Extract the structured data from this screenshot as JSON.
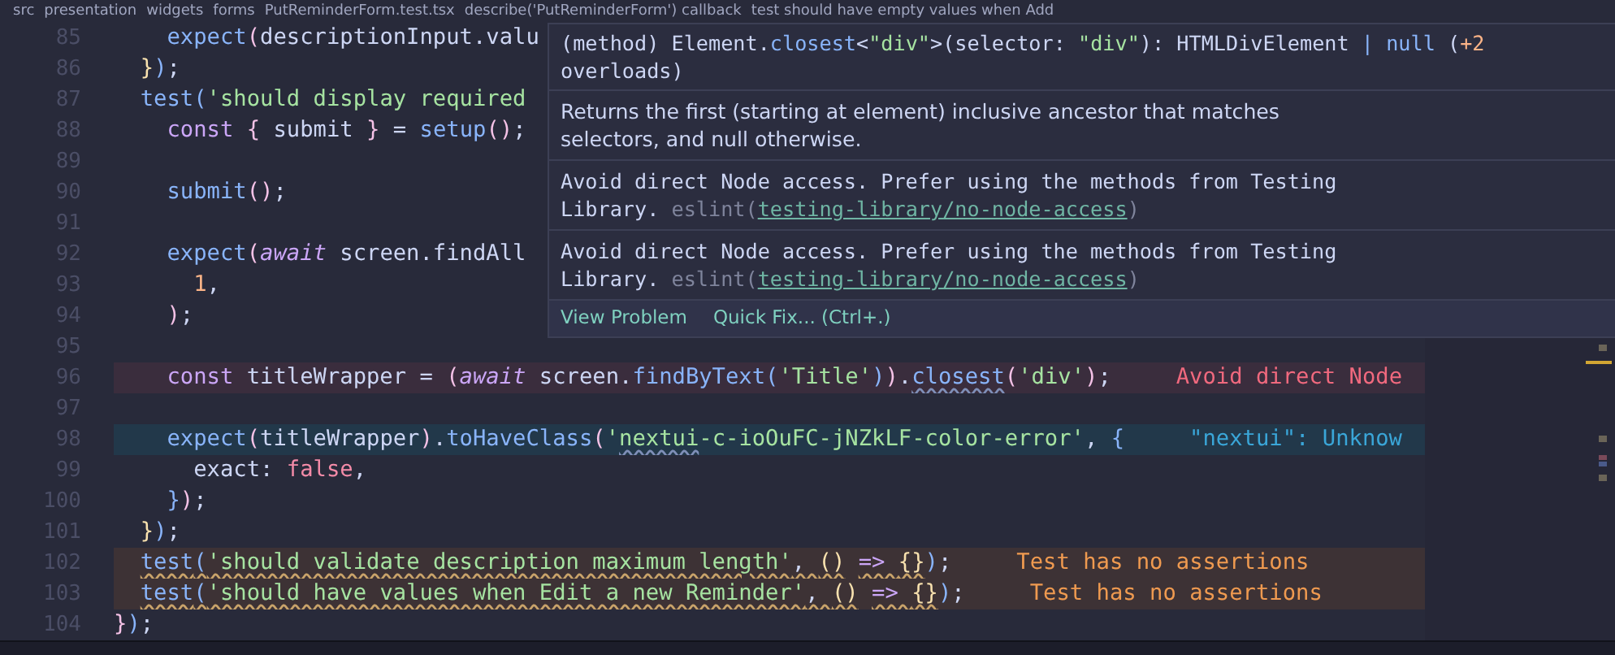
{
  "breadcrumb": [
    "src",
    "presentation",
    "widgets",
    "forms",
    "PutReminderForm.test.tsx",
    "describe('PutReminderForm') callback",
    "test should have empty values when Add"
  ],
  "lines": [
    {
      "number": "85",
      "tokens": [
        {
          "text": "    expect",
          "kind": "fn"
        },
        {
          "text": "(",
          "kind": "br2"
        },
        {
          "text": "descriptionInput.valu",
          "kind": "plain"
        }
      ]
    },
    {
      "number": "86",
      "tokens": [
        {
          "text": "  }",
          "kind": "br1"
        },
        {
          "text": ")",
          "kind": "br3"
        },
        {
          "text": ";",
          "kind": "plain"
        }
      ]
    },
    {
      "number": "87",
      "tokens": [
        {
          "text": "  test",
          "kind": "fn"
        },
        {
          "text": "(",
          "kind": "br3"
        },
        {
          "text": "'should display required",
          "kind": "str"
        }
      ]
    },
    {
      "number": "88",
      "tokens": [
        {
          "text": "    const ",
          "kind": "kw"
        },
        {
          "text": "{",
          "kind": "br2"
        },
        {
          "text": " submit ",
          "kind": "plain"
        },
        {
          "text": "}",
          "kind": "br2"
        },
        {
          "text": " = ",
          "kind": "plain"
        },
        {
          "text": "setup",
          "kind": "fn"
        },
        {
          "text": "()",
          "kind": "br2"
        },
        {
          "text": ";",
          "kind": "plain"
        }
      ]
    },
    {
      "number": "89"
    },
    {
      "number": "90",
      "tokens": [
        {
          "text": "    submit",
          "kind": "fn"
        },
        {
          "text": "()",
          "kind": "br2"
        },
        {
          "text": ";",
          "kind": "plain"
        }
      ]
    },
    {
      "number": "91"
    },
    {
      "number": "92",
      "tokens": [
        {
          "text": "    expect",
          "kind": "fn"
        },
        {
          "text": "(",
          "kind": "br2"
        },
        {
          "text": "await",
          "kind": "kwi"
        },
        {
          "text": " screen.findAll",
          "kind": "plain"
        }
      ]
    },
    {
      "number": "93",
      "tokens": [
        {
          "text": "      1",
          "kind": "num"
        },
        {
          "text": ",",
          "kind": "plain"
        }
      ]
    },
    {
      "number": "94",
      "tokens": [
        {
          "text": "    )",
          "kind": "br2"
        },
        {
          "text": ";",
          "kind": "plain"
        }
      ]
    },
    {
      "number": "95"
    },
    {
      "number": "96",
      "kind": "error",
      "diagnostic": "Avoid direct Node",
      "tokens": [
        {
          "text": "    const ",
          "kind": "kw"
        },
        {
          "text": "titleWrapper = ",
          "kind": "plain"
        },
        {
          "text": "(",
          "kind": "br2"
        },
        {
          "text": "await",
          "kind": "kwi"
        },
        {
          "text": " screen.",
          "kind": "plain"
        },
        {
          "text": "findByText",
          "kind": "fn"
        },
        {
          "text": "(",
          "kind": "br3"
        },
        {
          "text": "'Title'",
          "kind": "str"
        },
        {
          "text": ")",
          "kind": "br3"
        },
        {
          "text": ")",
          "kind": "br2"
        },
        {
          "text": ".",
          "kind": "plain"
        },
        {
          "text": "closest",
          "kind": "fn",
          "squiggly": true
        },
        {
          "text": "(",
          "kind": "br2"
        },
        {
          "text": "'div'",
          "kind": "str"
        },
        {
          "text": ")",
          "kind": "br2"
        },
        {
          "text": ";",
          "kind": "plain"
        }
      ]
    },
    {
      "number": "97"
    },
    {
      "number": "98",
      "kind": "info",
      "diagnostic": "\"nextui\": Unknow",
      "tokens": [
        {
          "text": "    expect",
          "kind": "fn"
        },
        {
          "text": "(",
          "kind": "br2"
        },
        {
          "text": "titleWrapper",
          "kind": "plain"
        },
        {
          "text": ")",
          "kind": "br2"
        },
        {
          "text": ".",
          "kind": "plain"
        },
        {
          "text": "toHaveClass",
          "kind": "fn"
        },
        {
          "text": "(",
          "kind": "br2"
        },
        {
          "text": "'",
          "kind": "str"
        },
        {
          "text": "nextui",
          "kind": "str",
          "squiggly": true
        },
        {
          "text": "-c-ioOuFC-jNZkLF-color-error'",
          "kind": "str"
        },
        {
          "text": ", ",
          "kind": "plain"
        },
        {
          "text": "{",
          "kind": "br3"
        }
      ]
    },
    {
      "number": "99",
      "tokens": [
        {
          "text": "      exact: ",
          "kind": "plain"
        },
        {
          "text": "false",
          "kind": "bool"
        },
        {
          "text": ",",
          "kind": "plain"
        }
      ]
    },
    {
      "number": "100",
      "tokens": [
        {
          "text": "    }",
          "kind": "br3"
        },
        {
          "text": ")",
          "kind": "br2"
        },
        {
          "text": ";",
          "kind": "plain"
        }
      ]
    },
    {
      "number": "101",
      "tokens": [
        {
          "text": "  }",
          "kind": "br1"
        },
        {
          "text": ")",
          "kind": "br3"
        },
        {
          "text": ";",
          "kind": "plain"
        }
      ]
    },
    {
      "number": "102",
      "kind": "warning",
      "diagnostic": "Test has no assertions",
      "tokens": [
        {
          "text": "  test",
          "kind": "fn",
          "squiggly": true
        },
        {
          "text": "(",
          "kind": "br3",
          "squiggly": true
        },
        {
          "text": "'should validate description maximum length'",
          "kind": "str",
          "squiggly": true
        },
        {
          "text": ", ",
          "kind": "plain",
          "squiggly": true
        },
        {
          "text": "()",
          "kind": "br1",
          "squiggly": true
        },
        {
          "text": " => ",
          "kind": "kw",
          "squiggly": true
        },
        {
          "text": "{}",
          "kind": "br1",
          "squiggly": true
        },
        {
          "text": ")",
          "kind": "br3"
        },
        {
          "text": ";",
          "kind": "plain"
        }
      ]
    },
    {
      "number": "103",
      "kind": "warning",
      "diagnostic": "Test has no assertions",
      "tokens": [
        {
          "text": "  test",
          "kind": "fn",
          "squiggly": true
        },
        {
          "text": "(",
          "kind": "br3",
          "squiggly": true
        },
        {
          "text": "'should have values when Edit a new Reminder'",
          "kind": "str",
          "squiggly": true
        },
        {
          "text": ", ",
          "kind": "plain",
          "squiggly": true
        },
        {
          "text": "()",
          "kind": "br1",
          "squiggly": true
        },
        {
          "text": " => ",
          "kind": "kw",
          "squiggly": true
        },
        {
          "text": "{}",
          "kind": "br1",
          "squiggly": true
        },
        {
          "text": ")",
          "kind": "br3"
        },
        {
          "text": ";",
          "kind": "plain"
        }
      ]
    },
    {
      "number": "104",
      "tokens": [
        {
          "text": "}",
          "kind": "br2"
        },
        {
          "text": ")",
          "kind": "br3"
        },
        {
          "text": ";",
          "kind": "plain"
        }
      ]
    }
  ],
  "hover": {
    "signature": [
      {
        "text": "(method) Element.",
        "kind": "plain"
      },
      {
        "text": "closest",
        "kind": "fn"
      },
      {
        "text": "<",
        "kind": "plain"
      },
      {
        "text": "\"div\"",
        "kind": "str"
      },
      {
        "text": ">(selector: ",
        "kind": "plain"
      },
      {
        "text": "\"div\"",
        "kind": "str"
      },
      {
        "text": "): HTMLDivElement ",
        "kind": "plain"
      },
      {
        "text": "|",
        "kind": "fn"
      },
      {
        "text": " null",
        "kind": "fn"
      },
      {
        "text": " (",
        "kind": "plain"
      },
      {
        "text": "+2",
        "kind": "num"
      },
      {
        "text": " overloads)",
        "kind": "plain"
      }
    ],
    "documentation": "Returns the first (starting at element) inclusive ancestor that matches selectors, and null otherwise.",
    "problems": [
      {
        "message": "Avoid direct Node access. Prefer using the methods from Testing Library.",
        "source": "eslint(",
        "rule": "testing-library/no-node-access",
        "close": ")"
      },
      {
        "message": "Avoid direct Node access. Prefer using the methods from Testing Library.",
        "source": "eslint(",
        "rule": "testing-library/no-node-access",
        "close": ")"
      }
    ],
    "actions": [
      "View Problem",
      "Quick Fix... (Ctrl+.)"
    ]
  }
}
